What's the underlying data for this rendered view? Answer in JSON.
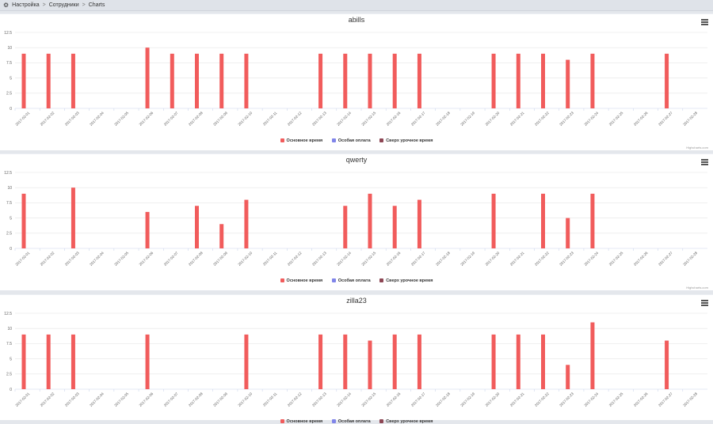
{
  "breadcrumb": {
    "items": [
      "Настройка",
      "Сотрудники",
      "Charts"
    ],
    "separator": ">"
  },
  "legend_labels": [
    "Основное время",
    "Особая оплата",
    "Сверх урочное время"
  ],
  "legend_colors": [
    "#f15c5c",
    "#8085e9",
    "#8d4654"
  ],
  "credits": "Highcharts.com",
  "chart_data": [
    {
      "type": "bar",
      "title": "abills",
      "categories": [
        "2017-02-01",
        "2017-02-02",
        "2017-02-03",
        "2017-02-04",
        "2017-02-05",
        "2017-02-06",
        "2017-02-07",
        "2017-02-08",
        "2017-02-09",
        "2017-02-10",
        "2017-02-11",
        "2017-02-12",
        "2017-02-13",
        "2017-02-14",
        "2017-02-15",
        "2017-02-16",
        "2017-02-17",
        "2017-02-18",
        "2017-02-19",
        "2017-02-20",
        "2017-02-21",
        "2017-02-22",
        "2017-02-23",
        "2017-02-24",
        "2017-02-25",
        "2017-02-26",
        "2017-02-27",
        "2017-02-28"
      ],
      "yticks": [
        "0",
        "2.5",
        "5",
        "7.5",
        "10",
        "12.5"
      ],
      "ylim": [
        0,
        12.5
      ],
      "series": [
        {
          "name": "Основное время",
          "values": [
            9,
            9,
            9,
            0,
            0,
            10,
            9,
            9,
            9,
            9,
            0,
            0,
            9,
            9,
            9,
            9,
            9,
            0,
            0,
            9,
            9,
            9,
            8,
            9,
            0,
            0,
            9,
            0
          ]
        },
        {
          "name": "Особая оплата",
          "values": [
            0,
            0,
            0,
            0,
            0,
            0,
            0,
            0,
            0,
            0,
            0,
            0,
            0,
            0,
            0,
            0,
            0,
            0,
            0,
            0,
            0,
            0,
            0,
            0,
            0,
            0,
            0,
            0
          ]
        },
        {
          "name": "Сверх урочное время",
          "values": [
            0,
            0,
            0,
            0,
            0,
            0,
            0,
            0,
            0,
            0,
            0,
            0,
            0,
            0,
            0,
            0,
            0,
            0,
            0,
            0,
            0,
            0,
            0,
            0,
            0,
            0,
            0,
            0
          ]
        }
      ],
      "legend": "bottom-center",
      "grid": true
    },
    {
      "type": "bar",
      "title": "qwerty",
      "categories": [
        "2017-02-01",
        "2017-02-02",
        "2017-02-03",
        "2017-02-04",
        "2017-02-05",
        "2017-02-06",
        "2017-02-07",
        "2017-02-08",
        "2017-02-09",
        "2017-02-10",
        "2017-02-11",
        "2017-02-12",
        "2017-02-13",
        "2017-02-14",
        "2017-02-15",
        "2017-02-16",
        "2017-02-17",
        "2017-02-18",
        "2017-02-19",
        "2017-02-20",
        "2017-02-21",
        "2017-02-22",
        "2017-02-23",
        "2017-02-24",
        "2017-02-25",
        "2017-02-26",
        "2017-02-27",
        "2017-02-28"
      ],
      "yticks": [
        "0",
        "2.5",
        "5",
        "7.5",
        "10",
        "12.5"
      ],
      "ylim": [
        0,
        12.5
      ],
      "series": [
        {
          "name": "Основное время",
          "values": [
            9,
            0,
            10,
            0,
            0,
            6,
            0,
            7,
            4,
            8,
            0,
            0,
            0,
            7,
            9,
            7,
            8,
            0,
            0,
            9,
            0,
            9,
            5,
            9,
            0,
            0,
            0,
            0
          ]
        },
        {
          "name": "Особая оплата",
          "values": [
            0,
            0,
            0,
            0,
            0,
            0,
            0,
            0,
            0,
            0,
            0,
            0,
            0,
            0,
            0,
            0,
            0,
            0,
            0,
            0,
            0,
            0,
            0,
            0,
            0,
            0,
            0,
            0
          ]
        },
        {
          "name": "Сверх урочное время",
          "values": [
            0,
            0,
            0,
            0,
            0,
            0,
            0,
            0,
            0,
            0,
            0,
            0,
            0,
            0,
            0,
            0,
            0,
            0,
            0,
            0,
            0,
            0,
            0,
            0,
            0,
            0,
            0,
            0
          ]
        }
      ],
      "legend": "bottom-center",
      "grid": true
    },
    {
      "type": "bar",
      "title": "zilla23",
      "categories": [
        "2017-02-01",
        "2017-02-02",
        "2017-02-03",
        "2017-02-04",
        "2017-02-05",
        "2017-02-06",
        "2017-02-07",
        "2017-02-08",
        "2017-02-09",
        "2017-02-10",
        "2017-02-11",
        "2017-02-12",
        "2017-02-13",
        "2017-02-14",
        "2017-02-15",
        "2017-02-16",
        "2017-02-17",
        "2017-02-18",
        "2017-02-19",
        "2017-02-20",
        "2017-02-21",
        "2017-02-22",
        "2017-02-23",
        "2017-02-24",
        "2017-02-25",
        "2017-02-26",
        "2017-02-27",
        "2017-02-28"
      ],
      "yticks": [
        "0",
        "2.5",
        "5",
        "7.5",
        "10",
        "12.5"
      ],
      "ylim": [
        0,
        12.5
      ],
      "series": [
        {
          "name": "Основное время",
          "values": [
            9,
            9,
            9,
            0,
            0,
            9,
            0,
            0,
            0,
            9,
            0,
            0,
            9,
            9,
            8,
            9,
            9,
            0,
            0,
            9,
            9,
            9,
            4,
            11,
            0,
            0,
            8,
            0
          ]
        },
        {
          "name": "Особая оплата",
          "values": [
            0,
            0,
            0,
            0,
            0,
            0,
            0,
            0,
            0,
            0,
            0,
            0,
            0,
            0,
            0,
            0,
            0,
            0,
            0,
            0,
            0,
            0,
            0,
            0,
            0,
            0,
            0,
            0
          ]
        },
        {
          "name": "Сверх урочное время",
          "values": [
            0,
            0,
            0,
            0,
            0,
            0,
            0,
            0,
            0,
            0,
            0,
            0,
            0,
            0,
            0,
            0,
            0,
            0,
            0,
            0,
            0,
            0,
            0,
            0,
            0,
            0,
            0,
            0
          ]
        }
      ],
      "legend": "bottom-center",
      "grid": true
    }
  ]
}
